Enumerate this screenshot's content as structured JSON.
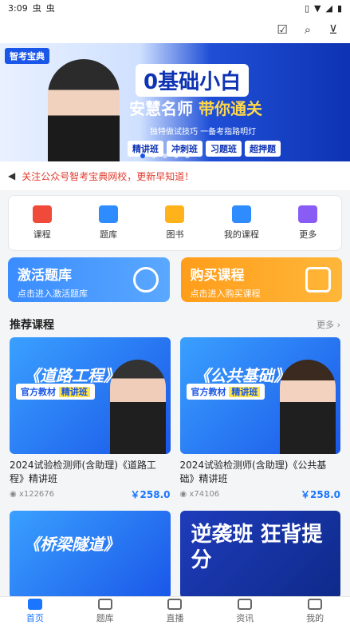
{
  "status": {
    "time": "3:09",
    "notif1": "虫",
    "notif2": "虫"
  },
  "banner": {
    "logo": "智考宝典",
    "headline": "0基础小白",
    "sub_a": "安慧名师",
    "sub_b": "带你通关",
    "line": "独特做试技巧 一备考指路明灯",
    "tags": [
      "精讲班",
      "冲刺班",
      "习题班",
      "超押题"
    ]
  },
  "notice": {
    "text": "关注公众号智考宝典网校，更新早知道！"
  },
  "nav": {
    "items": [
      {
        "label": "课程",
        "icon": "course-icon",
        "color": "#f04a3a"
      },
      {
        "label": "题库",
        "icon": "question-bank-icon",
        "color": "#2f8cff"
      },
      {
        "label": "图书",
        "icon": "book-icon",
        "color": "#ffb21a"
      },
      {
        "label": "我的课程",
        "icon": "my-course-icon",
        "color": "#2f8cff"
      },
      {
        "label": "更多",
        "icon": "more-icon",
        "color": "#8a5cf6"
      }
    ]
  },
  "cards": {
    "activate": {
      "title": "激活题库",
      "sub": "点击进入激活题库"
    },
    "buy": {
      "title": "购买课程",
      "sub": "点击进入购买课程"
    }
  },
  "recommend": {
    "title": "推荐课程",
    "more": "更多"
  },
  "courses": [
    {
      "cover_title": "《道路工程》",
      "badge_a": "官方教材",
      "badge_b": "精讲班",
      "name": "2024试验检测师(含助理)《道路工程》精讲班",
      "views": "x122676",
      "price": "￥258.0"
    },
    {
      "cover_title": "《公共基础》",
      "badge_a": "官方教材",
      "badge_b": "精讲班",
      "name": "2024试验检测师(含助理)《公共基础》精讲班",
      "views": "x74106",
      "price": "￥258.0"
    }
  ],
  "bottom_covers": [
    {
      "cover_title": "《桥梁隧道》"
    },
    {
      "cover_title": "逆袭班 狂背提分"
    }
  ],
  "tabbar": {
    "tabs": [
      "首页",
      "题库",
      "直播",
      "资讯",
      "我的"
    ]
  }
}
